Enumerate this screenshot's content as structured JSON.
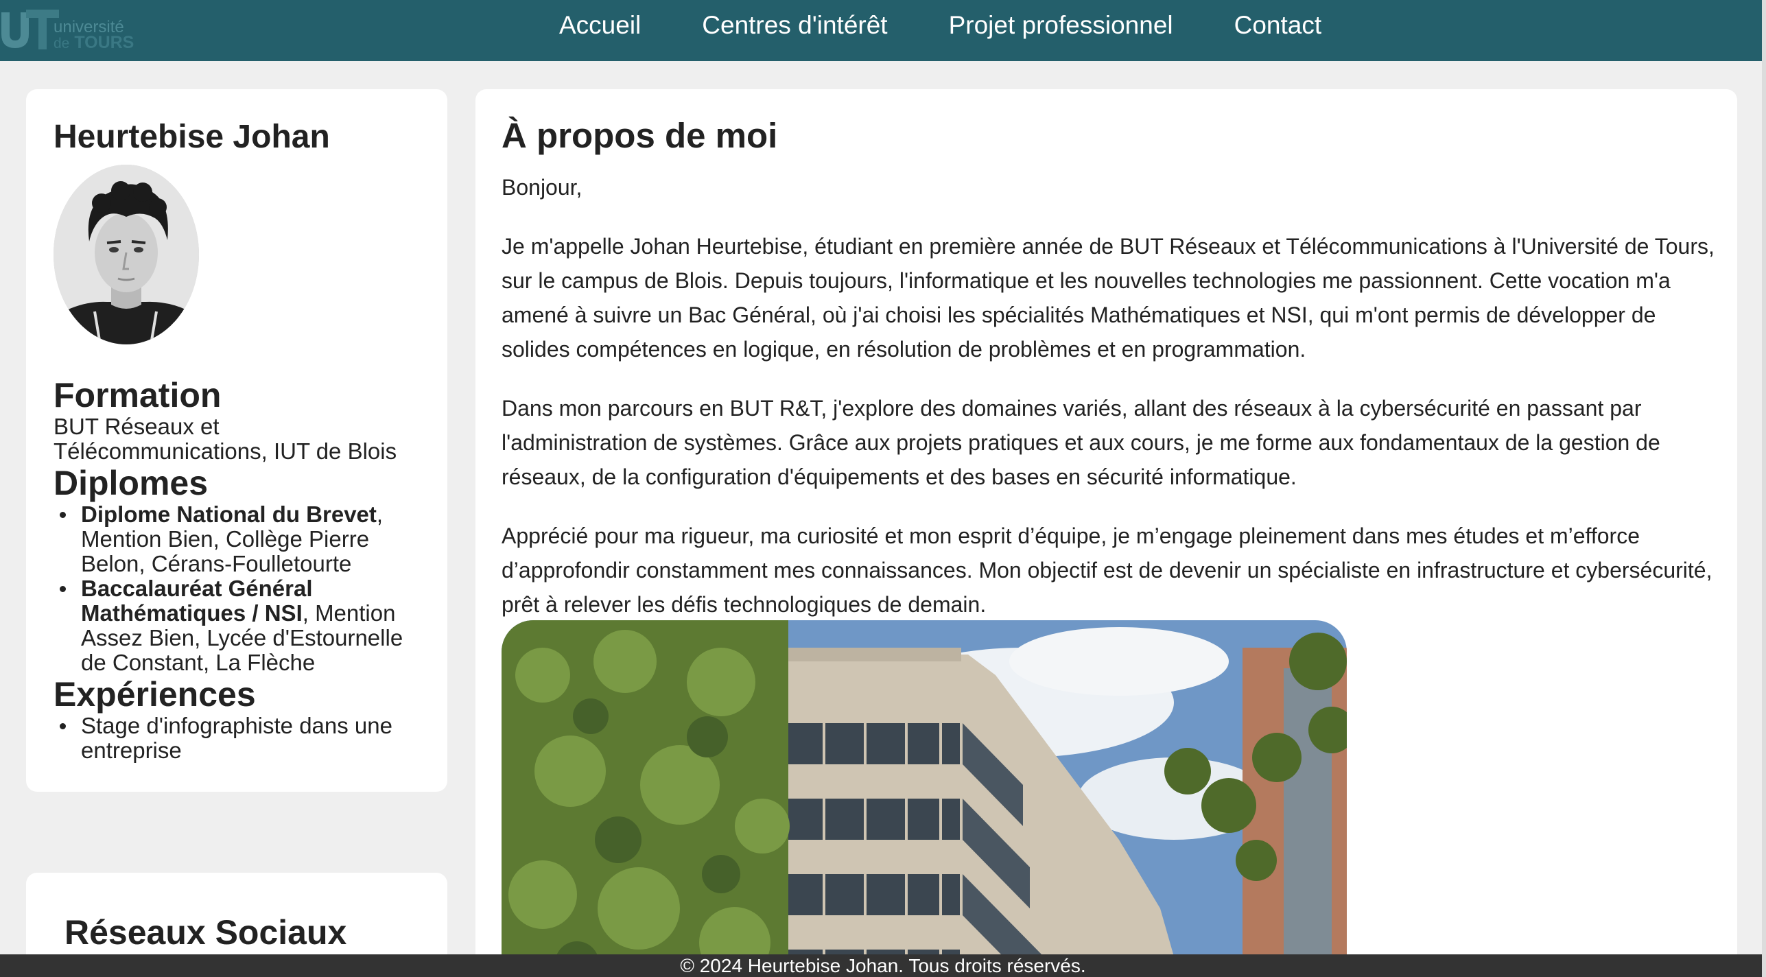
{
  "header": {
    "logo": {
      "line1": "université",
      "line2_prefix": "de",
      "line2_main": "TOURS"
    },
    "nav": [
      {
        "label": "Accueil"
      },
      {
        "label": "Centres d'intérêt"
      },
      {
        "label": "Projet professionnel"
      },
      {
        "label": "Contact"
      }
    ]
  },
  "sidebar": {
    "name": "Heurtebise Johan",
    "formation": {
      "title": "Formation",
      "text": "BUT Réseaux et Télécommunications, IUT de Blois"
    },
    "diplomes": {
      "title": "Diplomes",
      "items": [
        {
          "bold": "Diplome National du Brevet",
          "rest": ", Mention Bien, Collège Pierre Belon, Cérans-Foulletourte"
        },
        {
          "bold": "Baccalauréat Général Mathématiques / NSI",
          "rest": ", Mention Assez Bien, Lycée d'Estournelle de Constant, La Flèche"
        }
      ]
    },
    "experiences": {
      "title": "Expériences",
      "items": [
        {
          "text": "Stage d'infographiste dans une entreprise"
        }
      ]
    }
  },
  "social": {
    "title": "Réseaux Sociaux"
  },
  "main": {
    "title": "À propos de moi",
    "greeting": "Bonjour,",
    "paragraphs": [
      "Je m'appelle Johan Heurtebise, étudiant en première année de BUT Réseaux et Télécommunications à l'Université de Tours, sur le campus de Blois. Depuis toujours, l'informatique et les nouvelles technologies me passionnent. Cette vocation m'a amené à suivre un Bac Général, où j'ai choisi les spécialités Mathématiques et NSI, qui m'ont permis de développer de solides compétences en logique, en résolution de problèmes et en programmation.",
      "Dans mon parcours en BUT R&T, j'explore des domaines variés, allant des réseaux à la cybersécurité en passant par l'administration de systèmes. Grâce aux projets pratiques et aux cours, je me forme aux fondamentaux de la gestion de réseaux, de la configuration d'équipements et des bases en sécurité informatique.",
      "Apprécié pour ma rigueur, ma curiosité et mon esprit d’équipe, je m’engage pleinement dans mes études et m’efforce d’approfondir constamment mes connaissances. Mon objectif est de devenir un spécialiste en infrastructure et cybersécurité, prêt à relever les défis technologiques de demain."
    ]
  },
  "footer": {
    "text": "© 2024 Heurtebise Johan. Tous droits réservés."
  },
  "colors": {
    "header_bg": "#245f6b",
    "page_bg": "#efefef",
    "card_bg": "#ffffff",
    "footer_bg": "#333333"
  }
}
